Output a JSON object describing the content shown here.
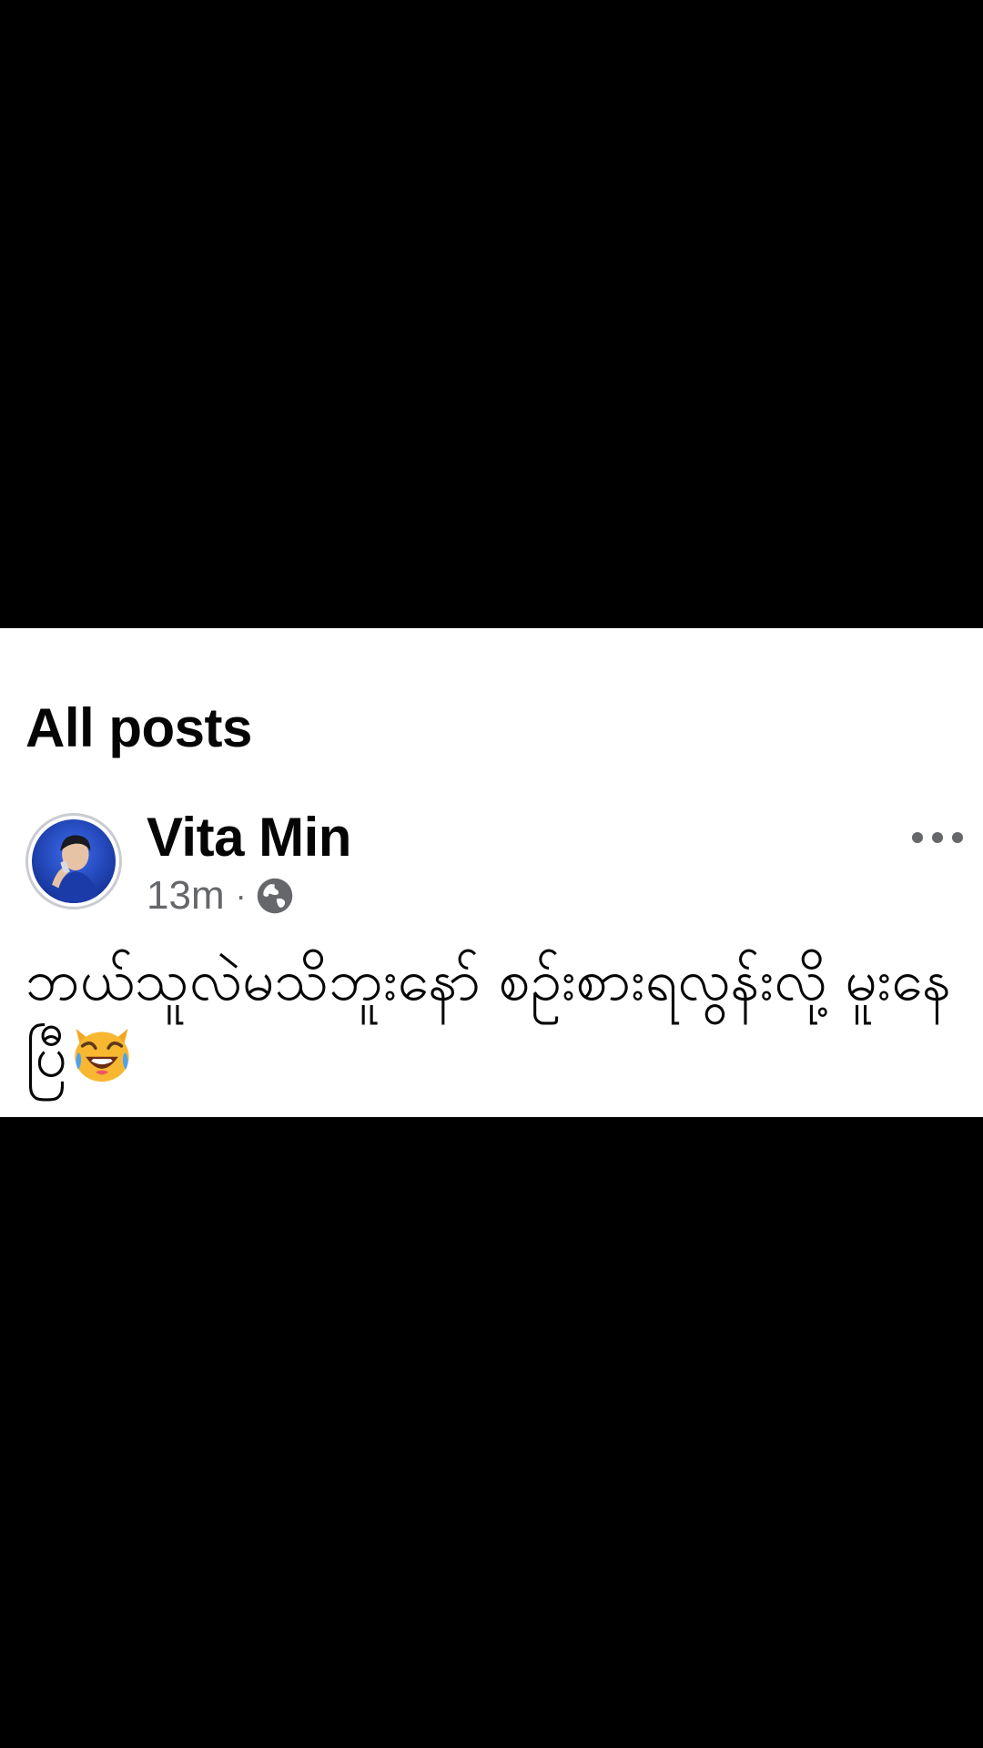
{
  "section": {
    "title": "All posts"
  },
  "post": {
    "author": "Vita Min",
    "time": "13m",
    "separator": "·",
    "visibility_icon": "globe-icon",
    "more_icon": "more-options-icon",
    "text": "ဘယ်သူလဲမသိဘူးနော် စဉ်းစားရလွန်းလို့ မူးနေပြီ",
    "emoji_icon": "cat-joy-tears-emoji"
  },
  "colors": {
    "background": "#000000",
    "card": "#ffffff",
    "text_primary": "#050505",
    "text_secondary": "#65676b",
    "avatar_blue": "#1a3fb0"
  }
}
